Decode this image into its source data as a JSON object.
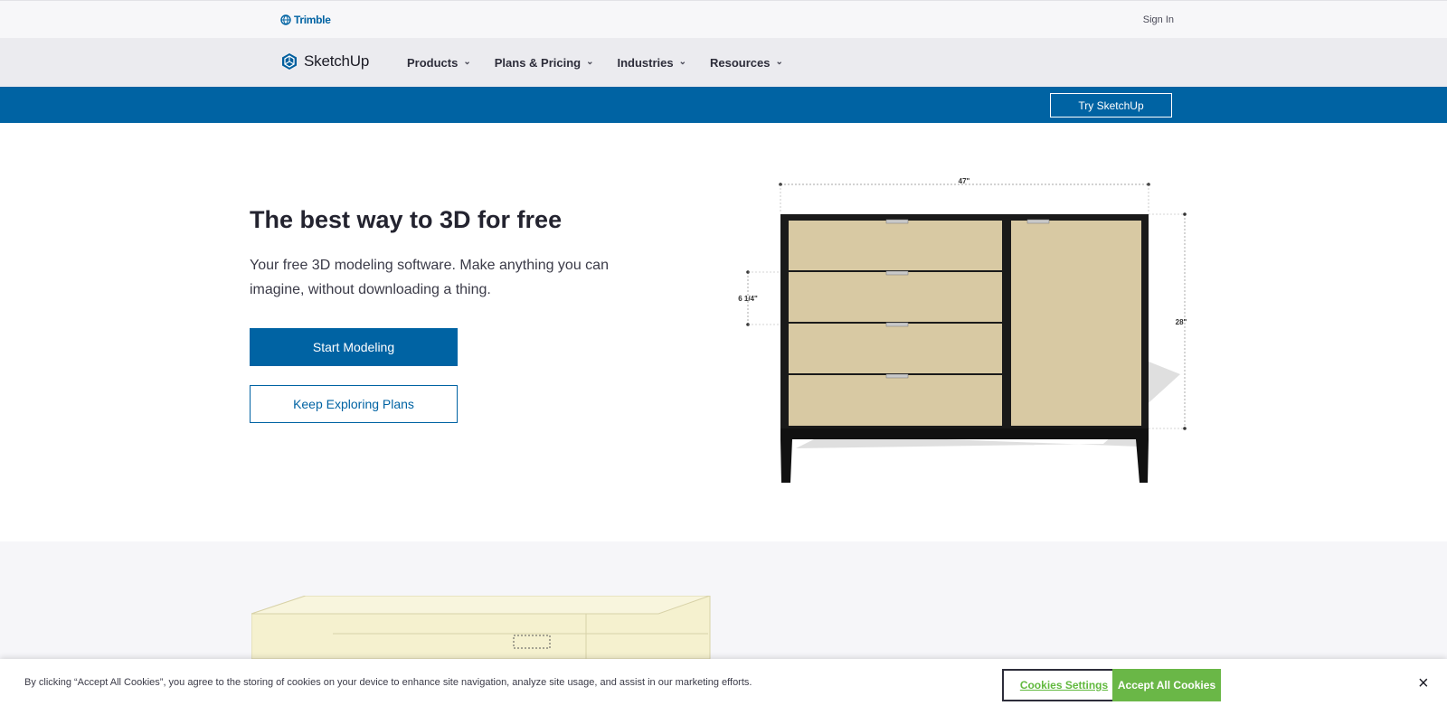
{
  "topbar": {
    "brand": "Trimble",
    "signin": "Sign In"
  },
  "nav": {
    "brand": "SketchUp",
    "items": [
      {
        "label": "Products"
      },
      {
        "label": "Plans & Pricing"
      },
      {
        "label": "Industries"
      },
      {
        "label": "Resources"
      }
    ],
    "chevron": "⌄"
  },
  "bluebar": {
    "cta": "Try SketchUp"
  },
  "hero": {
    "title": "The best way to 3D for free",
    "subtitle": "Your free 3D modeling software. Make anything you can imagine, without downloading a thing.",
    "primary_button": "Start Modeling",
    "secondary_button": "Keep Exploring Plans",
    "dimensions": {
      "width": "47\"",
      "drawer_height": "6 1/4\"",
      "height": "28\""
    }
  },
  "cookie": {
    "text": "By clicking “Accept All Cookies”, you agree to the storing of cookies on your device to enhance site navigation, analyze site usage, and assist in our marketing efforts.",
    "settings": "Cookies Settings",
    "accept": "Accept All Cookies",
    "close": "×"
  },
  "colors": {
    "brand_blue": "#0063a3",
    "accept_green": "#6ab747"
  }
}
